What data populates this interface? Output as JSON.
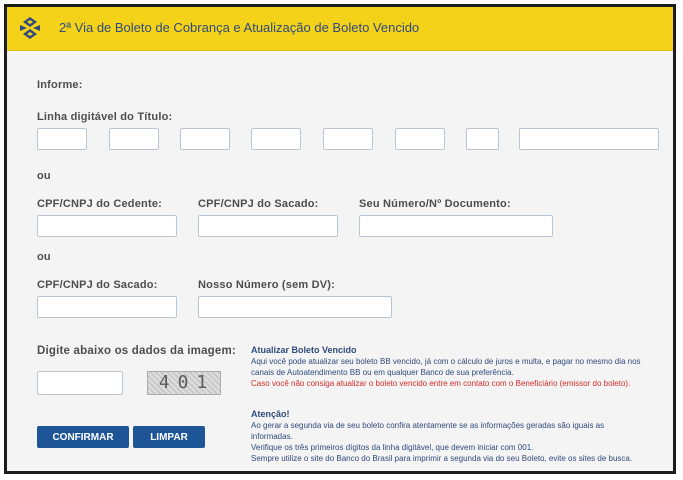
{
  "header": {
    "title": "2ª Via de Boleto de Cobrança e Atualização de Boleto Vencido"
  },
  "form": {
    "informe_label": "Informe:",
    "linha_label": "Linha digitável do Título:",
    "ou1": "ou",
    "cpf_cedente_label": "CPF/CNPJ do Cedente:",
    "cpf_sacado_label": "CPF/CNPJ do Sacado:",
    "seu_numero_label": "Seu Número/Nº Documento:",
    "ou2": "ou",
    "cpf_sacado2_label": "CPF/CNPJ do Sacado:",
    "nosso_numero_label": "Nosso Número (sem DV):",
    "captcha_label": "Digite abaixo os dados da imagem:",
    "captcha_text": "401"
  },
  "buttons": {
    "confirmar": "CONFIRMAR",
    "limpar": "LIMPAR"
  },
  "info": {
    "atualizar_title": "Atualizar Boleto Vencido",
    "atualizar_line1": "Aqui você pode atualizar seu boleto BB vencido, já com o cálculo de juros e multa, e pagar no mesmo dia nos",
    "atualizar_line2": "canais de Autoatendimento BB ou em qualquer Banco de sua preferência.",
    "atualizar_red": "Caso você não consiga atualizar o boleto vencido entre em contato com o Beneficiário (emissor do boleto).",
    "atencao_title": "Atenção!",
    "atencao_line1": "Ao gerar a segunda via de seu boleto confira atentamente se as informações geradas são iguais as",
    "atencao_line2": "informadas.",
    "atencao_line3": "Verifique os três primeiros dígitos da linha digitável, que devem iniciar com 001.",
    "atencao_line4": "Sempre utilize o site do Banco do Brasil para imprimir a segunda via do seu Boleto, evite os sites de busca."
  },
  "colors": {
    "header_bg": "#f5d21a",
    "button_bg": "#1d5597",
    "info_text": "#2f4a7c",
    "warning_text": "#d62b2b"
  },
  "icons": {
    "logo": "banco-do-brasil-logo"
  }
}
